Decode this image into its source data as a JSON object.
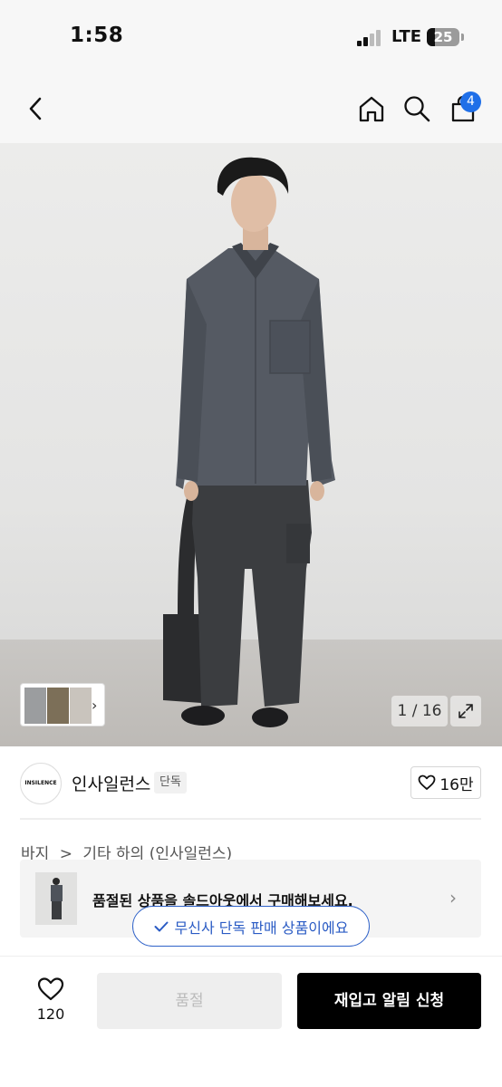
{
  "status_bar": {
    "time": "1:58",
    "network": "LTE",
    "battery": "25"
  },
  "nav": {
    "back_icon": "chevron-left-icon",
    "home_icon": "home-icon",
    "search_icon": "search-icon",
    "cart_icon": "shopping-bag-icon",
    "cart_count": "4"
  },
  "gallery": {
    "counter": "1 / 16",
    "expand_icon": "expand-icon",
    "current": 1,
    "total": 16
  },
  "brand": {
    "logo_text": "INSILENCE",
    "name": "인사일런스",
    "tag": "단독",
    "like_count": "16만"
  },
  "breadcrumb": {
    "items": [
      "바지",
      ">",
      "기타 하의 (인사일런스)"
    ]
  },
  "sold_out_banner": {
    "text": "품절된 상품을 솔드아웃에서 구매해보세요."
  },
  "exclusive": {
    "text": "무신사 단독 판매 상품이에요"
  },
  "bottom_bar": {
    "heart_count": "120",
    "soldout_label": "품절",
    "restock_label": "재입고 알림 신청"
  },
  "colors": {
    "accent_blue": "#1f6fe8",
    "pill_blue": "#2a5bc4",
    "black": "#000000"
  }
}
